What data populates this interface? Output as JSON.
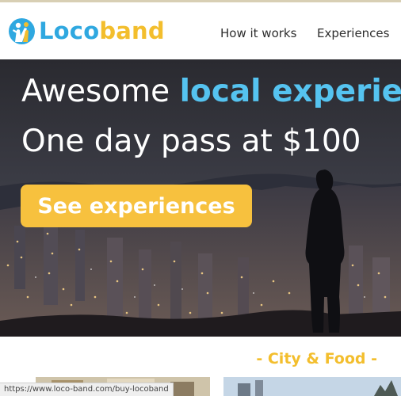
{
  "header": {
    "logo_blue": "Loco",
    "logo_yellow": "band",
    "nav": [
      "How it works",
      "Experiences"
    ]
  },
  "hero": {
    "line1_prefix": "Awesome ",
    "line1_accent": "local experien",
    "line2": "One day pass at $100",
    "cta_label": "See experiences"
  },
  "section": {
    "title": "- City & Food -"
  },
  "status_bar": {
    "url": "https://www.loco-band.com/buy-locoband"
  },
  "colors": {
    "brand_blue": "#2fa8e0",
    "brand_yellow": "#f3be2d",
    "accent_blue": "#55c3f0",
    "cta": "#f7c13e"
  }
}
